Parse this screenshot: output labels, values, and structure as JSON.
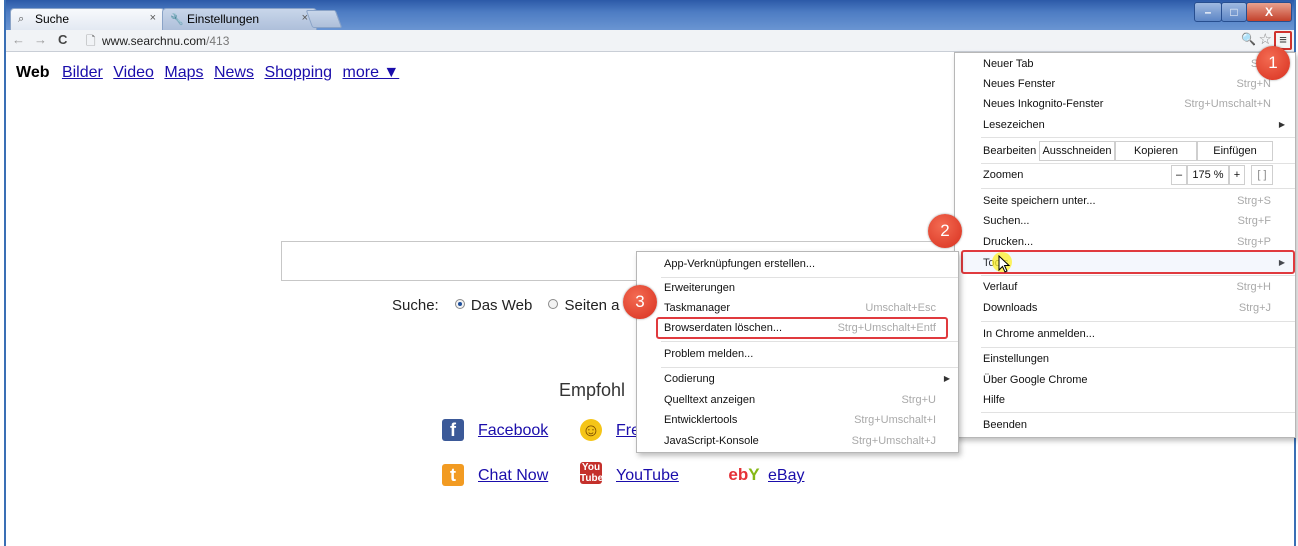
{
  "tabs": [
    {
      "label": "Suche",
      "icon": "search-icon"
    },
    {
      "label": "Einstellungen",
      "icon": "wrench-icon"
    }
  ],
  "window_controls": {
    "minimize": "–",
    "maximize": "□",
    "close": "X"
  },
  "address": {
    "host": "www.searchnu.com",
    "path": "/413"
  },
  "page": {
    "nav": {
      "first": "Web",
      "links": [
        "Bilder",
        "Video",
        "Maps",
        "News",
        "Shopping",
        "more ▼"
      ]
    },
    "search_label": "Suche:",
    "radio_options": [
      "Das Web",
      "Seiten a"
    ],
    "recommend": "Empfohl",
    "services": [
      "Facebook",
      "Fre",
      "Chat Now",
      "YouTube",
      "eBay"
    ]
  },
  "main_menu": {
    "new_tab": {
      "label": "Neuer Tab",
      "shortcut": "Strg"
    },
    "new_window": {
      "label": "Neues Fenster",
      "shortcut": "Strg+N"
    },
    "incognito": {
      "label": "Neues Inkognito-Fenster",
      "shortcut": "Strg+Umschalt+N"
    },
    "bookmarks": "Lesezeichen",
    "edit": {
      "label": "Bearbeiten",
      "cut": "Ausschneiden",
      "copy": "Kopieren",
      "paste": "Einfügen"
    },
    "zoom": {
      "label": "Zoomen",
      "minus": "–",
      "value": "175 %",
      "plus": "+",
      "fullscreen": "[ ]"
    },
    "save_page": {
      "label": "Seite speichern unter...",
      "shortcut": "Strg+S"
    },
    "find": {
      "label": "Suchen...",
      "shortcut": "Strg+F"
    },
    "print": {
      "label": "Drucken...",
      "shortcut": "Strg+P"
    },
    "tools": "Tools",
    "history": {
      "label": "Verlauf",
      "shortcut": "Strg+H"
    },
    "downloads": {
      "label": "Downloads",
      "shortcut": "Strg+J"
    },
    "signin": "In Chrome anmelden...",
    "settings": "Einstellungen",
    "about": "Über Google Chrome",
    "help": "Hilfe",
    "exit": "Beenden"
  },
  "tools_submenu": {
    "app_shortcuts": "App-Verknüpfungen erstellen...",
    "extensions": "Erweiterungen",
    "task_manager": {
      "label": "Taskmanager",
      "shortcut": "Umschalt+Esc"
    },
    "clear_data": {
      "label": "Browserdaten löschen...",
      "shortcut": "Strg+Umschalt+Entf"
    },
    "report": "Problem melden...",
    "encoding": "Codierung",
    "view_source": {
      "label": "Quelltext anzeigen",
      "shortcut": "Strg+U"
    },
    "devtools": {
      "label": "Entwicklertools",
      "shortcut": "Strg+Umschalt+I"
    },
    "js_console": {
      "label": "JavaScript-Konsole",
      "shortcut": "Strg+Umschalt+J"
    }
  },
  "badges": [
    "1",
    "2",
    "3"
  ],
  "colors": {
    "highlight": "#e03a3e",
    "badge": "#d8301f",
    "link": "#1a0dab",
    "title_bar": "#2c5aa8"
  }
}
